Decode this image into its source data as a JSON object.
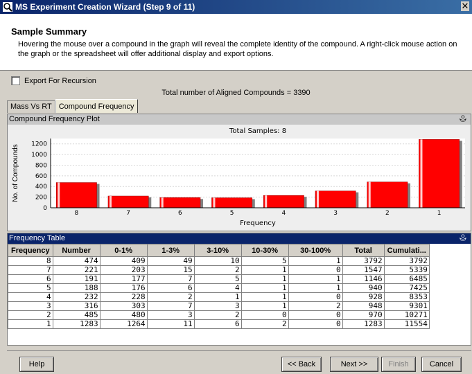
{
  "window": {
    "title": "MS Experiment Creation Wizard (Step 9 of 11)",
    "close_label": "✕"
  },
  "header": {
    "title": "Sample Summary",
    "description": "Hovering the mouse over a compound in the graph will reveal the complete identity of the compound. A right-click mouse action on the graph or the spreadsheet will offer additional display and export options."
  },
  "export": {
    "label": "Export For Recursion",
    "checked": false
  },
  "total_line": "Total number of Aligned Compounds = 3390",
  "tabs": [
    {
      "label": "Mass Vs RT"
    },
    {
      "label": "Compound Frequency"
    }
  ],
  "chart_panel": {
    "title": "Compound Frequency Plot",
    "pin": "⯕"
  },
  "chart_data": {
    "type": "bar",
    "title": "Total Samples: 8",
    "xlabel": "Frequency",
    "ylabel": "No. of Compounds",
    "categories": [
      "8",
      "7",
      "6",
      "5",
      "4",
      "3",
      "2",
      "1"
    ],
    "x_ticks": [
      "8",
      "7",
      "6",
      "5",
      "4",
      "3",
      "2",
      "1",
      "0"
    ],
    "values": [
      474,
      221,
      191,
      188,
      232,
      316,
      485,
      1283
    ],
    "ylim": [
      0,
      1300
    ],
    "y_ticks": [
      "0",
      "200",
      "400",
      "600",
      "800",
      "1000",
      "1200"
    ],
    "bar_color": "#ff0000"
  },
  "table_panel": {
    "title": "Frequency Table",
    "pin": "⯕"
  },
  "table": {
    "headers": [
      "Frequency",
      "Number",
      "0-1%",
      "1-3%",
      "3-10%",
      "10-30%",
      "30-100%",
      "Total",
      "Cumulati..."
    ],
    "rows": [
      [
        "8",
        "474",
        "409",
        "49",
        "10",
        "5",
        "1",
        "3792",
        "3792"
      ],
      [
        "7",
        "221",
        "203",
        "15",
        "2",
        "1",
        "0",
        "1547",
        "5339"
      ],
      [
        "6",
        "191",
        "177",
        "7",
        "5",
        "1",
        "1",
        "1146",
        "6485"
      ],
      [
        "5",
        "188",
        "176",
        "6",
        "4",
        "1",
        "1",
        "940",
        "7425"
      ],
      [
        "4",
        "232",
        "228",
        "2",
        "1",
        "1",
        "0",
        "928",
        "8353"
      ],
      [
        "3",
        "316",
        "303",
        "7",
        "3",
        "1",
        "2",
        "948",
        "9301"
      ],
      [
        "2",
        "485",
        "480",
        "3",
        "2",
        "0",
        "0",
        "970",
        "10271"
      ],
      [
        "1",
        "1283",
        "1264",
        "11",
        "6",
        "2",
        "0",
        "1283",
        "11554"
      ]
    ]
  },
  "buttons": {
    "help": "Help",
    "back": "<< Back",
    "next": "Next >>",
    "finish": "Finish",
    "cancel": "Cancel"
  }
}
